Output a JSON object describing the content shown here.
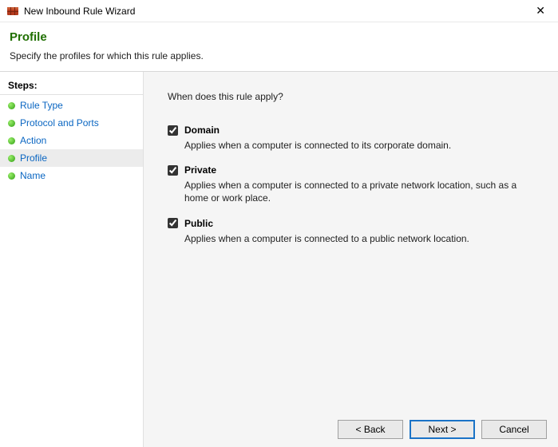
{
  "window": {
    "title": "New Inbound Rule Wizard"
  },
  "header": {
    "title": "Profile",
    "subtitle": "Specify the profiles for which this rule applies."
  },
  "steps": {
    "heading": "Steps:",
    "items": [
      {
        "label": "Rule Type",
        "current": false
      },
      {
        "label": "Protocol and Ports",
        "current": false
      },
      {
        "label": "Action",
        "current": false
      },
      {
        "label": "Profile",
        "current": true
      },
      {
        "label": "Name",
        "current": false
      }
    ]
  },
  "main": {
    "question": "When does this rule apply?",
    "options": [
      {
        "label": "Domain",
        "checked": true,
        "desc": "Applies when a computer is connected to its corporate domain."
      },
      {
        "label": "Private",
        "checked": true,
        "desc": "Applies when a computer is connected to a private network location, such as a home or work place."
      },
      {
        "label": "Public",
        "checked": true,
        "desc": "Applies when a computer is connected to a public network location."
      }
    ]
  },
  "buttons": {
    "back": "< Back",
    "next": "Next >",
    "cancel": "Cancel"
  }
}
